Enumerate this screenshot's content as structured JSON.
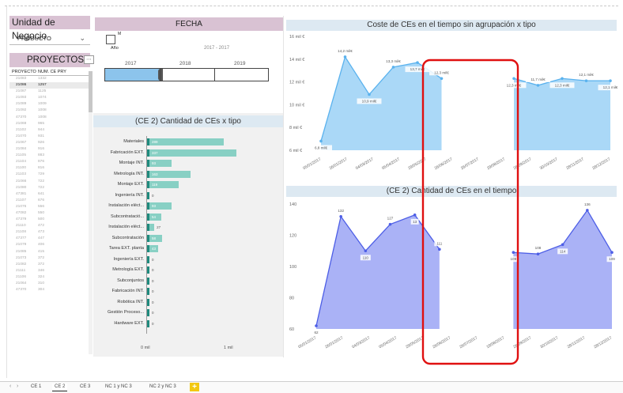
{
  "unidad": {
    "title": "Unidad de Negocio",
    "selected": "PRODUCTO",
    "chevron_icon": "chevron-down-icon"
  },
  "proyectos": {
    "title": "PROYECTOS",
    "col_proyecto": "PROYECTO",
    "col_num": "NUM. CE PRY",
    "rows": [
      {
        "p": "21083",
        "n": "1332"
      },
      {
        "p": "21086",
        "n": "1257",
        "selected": true
      },
      {
        "p": "21087",
        "n": "1125"
      },
      {
        "p": "21093",
        "n": "1074"
      },
      {
        "p": "21089",
        "n": "1009"
      },
      {
        "p": "21092",
        "n": "1008"
      },
      {
        "p": "47370",
        "n": "1008"
      },
      {
        "p": "21069",
        "n": "965"
      },
      {
        "p": "21102",
        "n": "944"
      },
      {
        "p": "21070",
        "n": "931"
      },
      {
        "p": "21067",
        "n": "926"
      },
      {
        "p": "21084",
        "n": "916"
      },
      {
        "p": "21105",
        "n": "883"
      },
      {
        "p": "21104",
        "n": "876"
      },
      {
        "p": "21100",
        "n": "816"
      },
      {
        "p": "21103",
        "n": "729"
      },
      {
        "p": "21066",
        "n": "722"
      },
      {
        "p": "21080",
        "n": "722"
      },
      {
        "p": "47381",
        "n": "641"
      },
      {
        "p": "21107",
        "n": "676"
      },
      {
        "p": "21076",
        "n": "556"
      },
      {
        "p": "47082",
        "n": "550"
      },
      {
        "p": "47379",
        "n": "500"
      },
      {
        "p": "21110",
        "n": "472"
      },
      {
        "p": "21108",
        "n": "473"
      },
      {
        "p": "47377",
        "n": "447"
      },
      {
        "p": "21079",
        "n": "406"
      },
      {
        "p": "21085",
        "n": "415"
      },
      {
        "p": "21073",
        "n": "372"
      },
      {
        "p": "21082",
        "n": "372"
      },
      {
        "p": "21111",
        "n": "346"
      },
      {
        "p": "21106",
        "n": "324"
      },
      {
        "p": "21064",
        "n": "310"
      },
      {
        "p": "47370",
        "n": "304"
      }
    ]
  },
  "fecha": {
    "title": "FECHA",
    "cal_label": "M",
    "anio_label": "Año",
    "range_text": "2017 - 2017",
    "years": [
      "2017",
      "2018",
      "2019"
    ],
    "calendar_icon": "calendar-icon"
  },
  "bar_chart": {
    "title": "(CE 2) Cantidad de CEs x tipo",
    "axis_labels": [
      "0 mil",
      "1 mil"
    ]
  },
  "area_chart_top": {
    "title": "Coste de CEs en el tiempo sin agrupación x tipo",
    "y_ticks": [
      "16 mil €",
      "14 mil €",
      "12 mil €",
      "10 mil €",
      "8 mil €",
      "6 mil €"
    ],
    "x_ticks": [
      "05/01/2017",
      "26/01/2017",
      "04/03/2017",
      "05/04/2017",
      "29/05/2017",
      "26/06/2017",
      "26/07/2017",
      "29/08/2017",
      "26/09/2017",
      "30/10/2017",
      "28/11/2017",
      "28/12/2017"
    ],
    "point_labels": [
      "6,8 mil€",
      "14,2 mil€",
      "10,9 mil€",
      "13,3 mil€",
      "13,7 mil€",
      "12,3 mil€",
      "12,3 mil€",
      "11,7 mil€",
      "12,3 mil€",
      "12,1 mil€",
      "12,1 mil€"
    ]
  },
  "area_chart_bottom": {
    "title": "(CE 2) Cantidad de CEs en el tiempo",
    "y_ticks": [
      "140",
      "120",
      "100",
      "80",
      "60"
    ],
    "x_ticks": [
      "05/01/2017",
      "26/01/2017",
      "04/03/2017",
      "05/04/2017",
      "29/05/2017",
      "26/06/2017",
      "26/07/2017",
      "18/08/2017",
      "26/09/2017",
      "30/10/2017",
      "28/11/2017",
      "28/12/2017"
    ],
    "point_labels": [
      "62",
      "132",
      "110",
      "127",
      "13",
      "111",
      "109",
      "108",
      "114",
      "136",
      "109"
    ]
  },
  "chart_data": [
    {
      "type": "bar",
      "title": "(CE 2) Cantidad de CEs x tipo",
      "categories": [
        "Materiales",
        "Fabricación EXT.",
        "Montaje INT.",
        "Metrología INT.",
        "Montaje EXT.",
        "Ingeniería INT.",
        "Instalación eléct...",
        "Subcontratació...",
        "Instalación eléct...",
        "Subcontratación",
        "Tarea EXT. planta",
        "Ingeniería EXT.",
        "Metrología EXT.",
        "Subconjuntos",
        "Fabricación INT.",
        "Robótica INT.",
        "Gestión Proceso...",
        "Hardware EXT."
      ],
      "values": [
        289,
        337,
        93,
        163,
        119,
        0,
        93,
        54,
        27,
        58,
        43,
        0,
        0,
        0,
        0,
        0,
        0,
        0
      ],
      "xlim": [
        0,
        1000
      ]
    },
    {
      "type": "area",
      "title": "Coste de CEs en el tiempo sin agrupación x tipo",
      "x": [
        "05/01/2017",
        "26/01/2017",
        "04/03/2017",
        "05/04/2017",
        "29/05/2017",
        "26/06/2017",
        "26/07/2017",
        "29/08/2017",
        "26/09/2017",
        "30/10/2017",
        "28/11/2017",
        "28/12/2017"
      ],
      "series": [
        {
          "values": [
            6.8,
            14.2,
            10.9,
            13.3,
            13.7,
            12.3,
            null,
            null,
            12.3,
            11.7,
            12.3,
            12.1,
            12.1
          ]
        }
      ],
      "ylim": [
        6,
        16
      ]
    },
    {
      "type": "area",
      "title": "(CE 2) Cantidad de CEs en el tiempo",
      "x": [
        "05/01/2017",
        "26/01/2017",
        "04/03/2017",
        "05/04/2017",
        "29/05/2017",
        "26/06/2017",
        "26/07/2017",
        "18/08/2017",
        "26/09/2017",
        "30/10/2017",
        "28/11/2017",
        "28/12/2017"
      ],
      "series": [
        {
          "values": [
            62,
            132,
            110,
            127,
            133,
            111,
            null,
            null,
            109,
            108,
            114,
            136,
            109
          ]
        }
      ],
      "ylim": [
        60,
        140
      ]
    }
  ],
  "tabs": {
    "items": [
      "CE 1",
      "CE 2",
      "CE 3",
      "NC 1 y NC 3",
      "NC 2 y NC 3"
    ],
    "active": 1,
    "add_label": "+"
  },
  "colors": {
    "slicer_header": "#d9c2d3",
    "bar_fill": "#88d0c4",
    "bar_accent": "#1f8a7d",
    "area_top": "#aad8f7",
    "area_top_line": "#5ab2ee",
    "area_bottom": "#aab2f6",
    "area_bottom_line": "#4d5ee6",
    "highlight": "#e01010",
    "add_tab": "#f2c811"
  }
}
